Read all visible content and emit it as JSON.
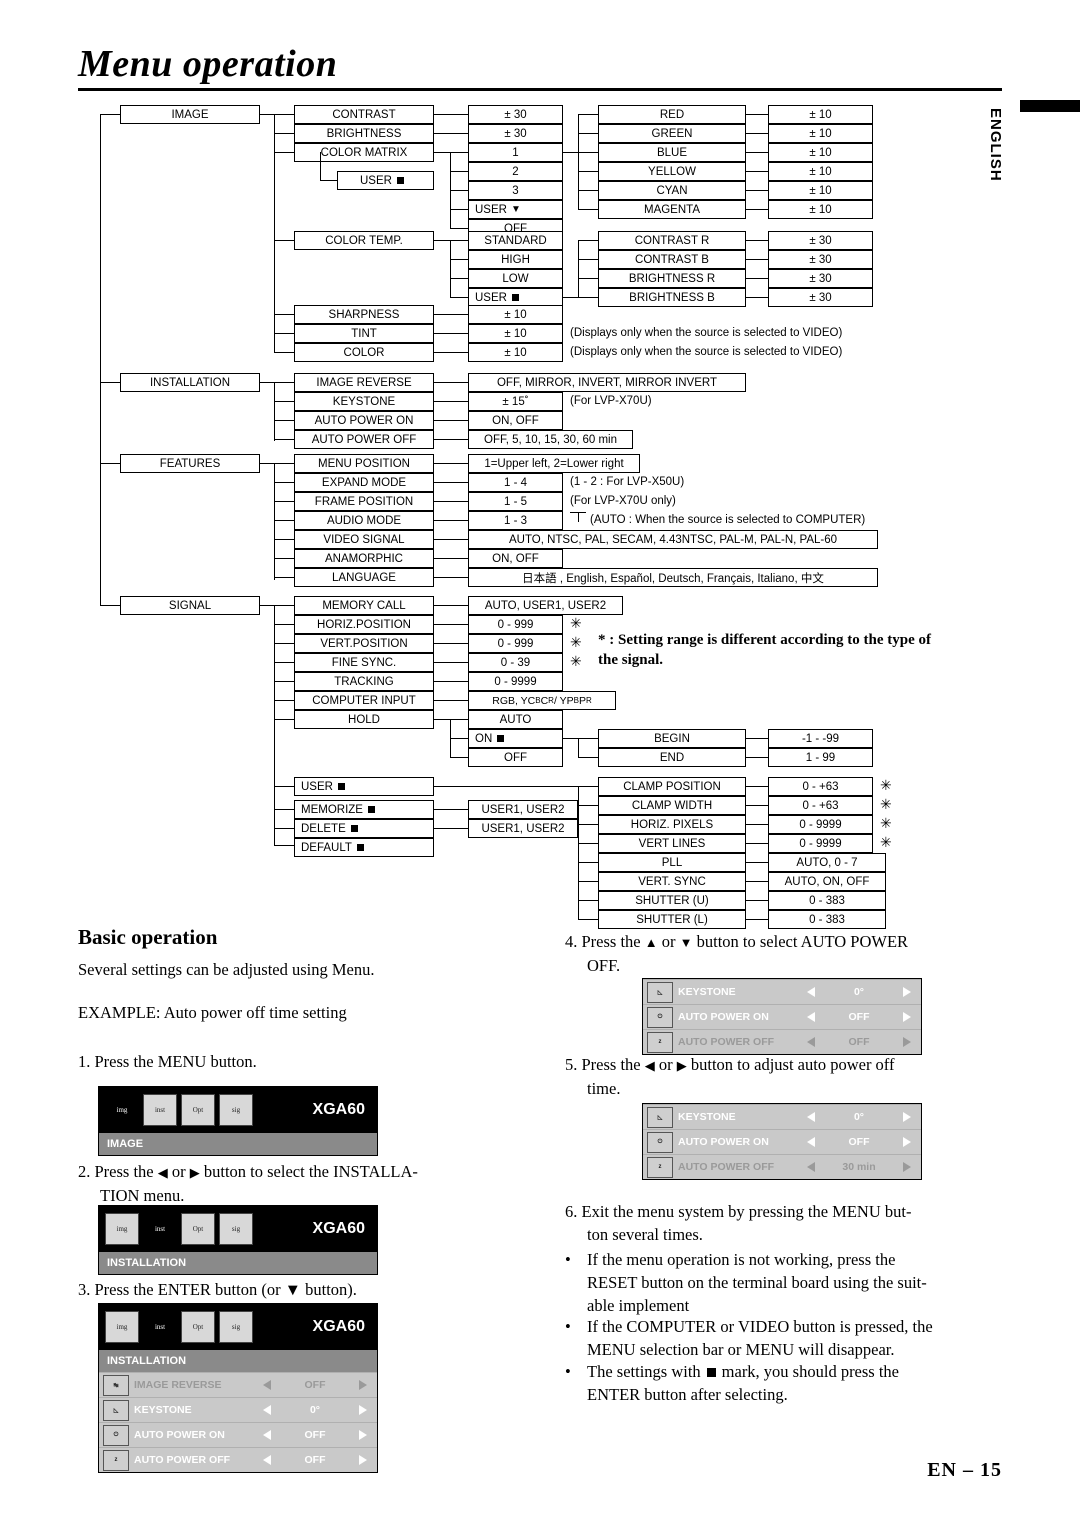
{
  "page": {
    "title": "Menu operation",
    "side_tab": "ENGLISH",
    "footer": "EN – 15"
  },
  "tree": {
    "level1": [
      {
        "label": "IMAGE"
      },
      {
        "label": "INSTALLATION"
      },
      {
        "label": "FEATURES"
      },
      {
        "label": "SIGNAL"
      }
    ],
    "image": {
      "items": [
        "CONTRAST",
        "BRIGHTNESS",
        "COLOR MATRIX",
        "COLOR TEMP.",
        "SHARPNESS",
        "TINT",
        "COLOR"
      ],
      "contrast_value": "± 30",
      "brightness_value": "± 30",
      "color_matrix_values": [
        "1",
        "2",
        "3",
        "USER",
        "OFF"
      ],
      "user_sub": "USER",
      "color_matrix_detail": [
        "RED",
        "GREEN",
        "BLUE",
        "YELLOW",
        "CYAN",
        "MAGENTA"
      ],
      "color_matrix_detail_values": [
        "± 10",
        "± 10",
        "± 10",
        "± 10",
        "± 10",
        "± 10"
      ],
      "color_temp_values": [
        "STANDARD",
        "HIGH",
        "LOW",
        "USER"
      ],
      "color_temp_detail": [
        "CONTRAST R",
        "CONTRAST B",
        "BRIGHTNESS R",
        "BRIGHTNESS B"
      ],
      "color_temp_detail_values": [
        "± 30",
        "± 30",
        "± 30",
        "± 30"
      ],
      "sharpness_value": "± 10",
      "tint_value": "± 10",
      "color_value": "± 10",
      "tint_note": "(Displays only when the source is selected to VIDEO)",
      "color_note": "(Displays only when the source is selected to VIDEO)"
    },
    "installation": {
      "items": [
        "IMAGE REVERSE",
        "KEYSTONE",
        "AUTO POWER ON",
        "AUTO POWER OFF"
      ],
      "values": [
        "OFF, MIRROR, INVERT, MIRROR INVERT",
        "± 15˚",
        "ON, OFF",
        "OFF, 5, 10, 15, 30, 60 min"
      ],
      "keystone_note": "(For LVP-X70U)"
    },
    "features": {
      "items": [
        "MENU POSITION",
        "EXPAND MODE",
        "FRAME POSITION",
        "AUDIO MODE",
        "VIDEO SIGNAL",
        "ANAMORPHIC",
        "LANGUAGE"
      ],
      "values": [
        "1=Upper left, 2=Lower right",
        "1 - 4",
        "1 - 5",
        "1 - 3",
        "AUTO, NTSC, PAL, SECAM, 4.43NTSC, PAL-M, PAL-N, PAL-60",
        "ON, OFF",
        "日本語 , English, Español, Deutsch, Français, Italiano, 中文"
      ],
      "expand_note": "(1 - 2 : For LVP-X50U)",
      "frame_note": "(For LVP-X70U only)",
      "audio_note": "(AUTO : When the source is selected to COMPUTER)"
    },
    "signal": {
      "items": [
        "MEMORY CALL",
        "HORIZ.POSITION",
        "VERT.POSITION",
        "FINE SYNC.",
        "TRACKING",
        "COMPUTER INPUT",
        "HOLD"
      ],
      "values": [
        "AUTO, USER1, USER2",
        "0 - 999",
        "0 - 999",
        "0 - 39",
        "0 - 9999",
        "RGB, YCBCR / YPBPR",
        "AUTO"
      ],
      "hold_sub": [
        "ON",
        "OFF"
      ],
      "hold_detail": [
        "BEGIN",
        "END"
      ],
      "hold_detail_values": [
        "-1 - -99",
        "1 - 99"
      ],
      "user_items": [
        "USER",
        "MEMORIZE",
        "DELETE",
        "DEFAULT"
      ],
      "user_values": [
        "USER1, USER2",
        "USER1, USER2"
      ],
      "user_detail": [
        "CLAMP POSITION",
        "CLAMP WIDTH",
        "HORIZ. PIXELS",
        "VERT LINES",
        "PLL",
        "VERT. SYNC",
        "SHUTTER (U)",
        "SHUTTER (L)"
      ],
      "user_detail_values": [
        "0 - +63",
        "0 - +63",
        "0 - 9999",
        "0 - 9999",
        "AUTO, 0 - 7",
        "AUTO, ON, OFF",
        "0 - 383",
        "0 - 383"
      ]
    },
    "callout": "* : Setting range is different according to the type of the signal."
  },
  "basic": {
    "heading": "Basic operation",
    "intro": "Several settings can be adjusted using Menu.",
    "example": "EXAMPLE: Auto power off time setting",
    "step1": "1. Press the MENU button.",
    "step2_a": "2. Press the ",
    "step2_b": " or ",
    "step2_c": " button to select the INSTALLA-",
    "step2_d": "TION menu.",
    "step3": "3. Press the ENTER button (or ▼ button).",
    "step4_a": "4. Press the ",
    "step4_b": " or ",
    "step4_c": " button to select AUTO POWER",
    "step4_d": "OFF.",
    "step5_a": "5. Press the ",
    "step5_b": " or ",
    "step5_c": " button to adjust auto power off",
    "step5_d": "time.",
    "step6_a": "6. Exit the menu system by pressing the MENU but-",
    "step6_b": "ton several times.",
    "bullets": [
      "If the menu operation is not working, press the RESET button on the terminal board using the suit- able implement",
      "If the COMPUTER or VIDEO button is pressed, the MENU selection bar or MENU will disappear.",
      "The settings with   mark, you should press the ENTER button after selecting."
    ],
    "bullet1_l1": "If the menu operation is not working, press the",
    "bullet1_l2": "RESET button on the terminal board using the suit-",
    "bullet1_l3": "able implement",
    "bullet2_l1": "If the COMPUTER or VIDEO button is pressed, the",
    "bullet2_l2": "MENU selection bar or MENU will disappear.",
    "bullet3_l1a": "The settings with",
    "bullet3_l1b": "mark, you should press the",
    "bullet3_l2": "ENTER button after selecting."
  },
  "osd": {
    "signal_label": "XGA60",
    "panel1": {
      "menu": "IMAGE"
    },
    "panel2": {
      "menu": "INSTALLATION"
    },
    "panel3": {
      "menu": "INSTALLATION",
      "rows": [
        {
          "label": "IMAGE REVERSE",
          "value": "OFF"
        },
        {
          "label": "KEYSTONE",
          "value": "0°"
        },
        {
          "label": "AUTO POWER ON",
          "value": "OFF"
        },
        {
          "label": "AUTO POWER OFF",
          "value": "OFF"
        }
      ]
    },
    "panel4": {
      "rows": [
        {
          "label": "KEYSTONE",
          "value": "0°"
        },
        {
          "label": "AUTO POWER ON",
          "value": "OFF"
        },
        {
          "label": "AUTO POWER OFF",
          "value": "OFF"
        }
      ]
    },
    "panel5": {
      "rows": [
        {
          "label": "KEYSTONE",
          "value": "0°"
        },
        {
          "label": "AUTO POWER ON",
          "value": "OFF"
        },
        {
          "label": "AUTO POWER OFF",
          "value": "30 min"
        }
      ]
    },
    "icon_names": [
      "image-icon",
      "installation-icon",
      "features-icon",
      "signal-icon"
    ]
  }
}
